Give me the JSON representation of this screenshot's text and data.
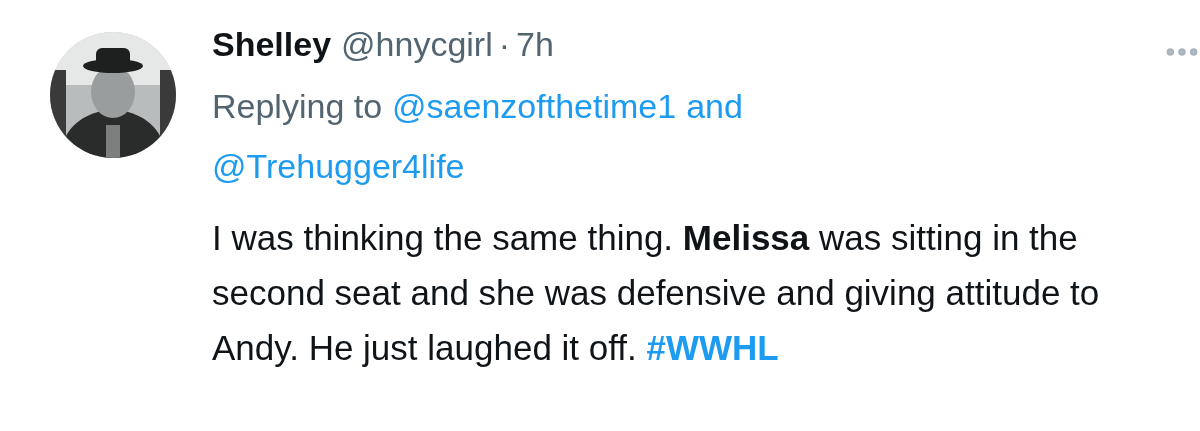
{
  "tweet": {
    "name": "Shelley",
    "handle": "@hnycgirl",
    "separator": "·",
    "time": "7h",
    "replying": {
      "prefix": "Replying to",
      "mentions": [
        "@saenzofthetime1",
        "@Trehugger4life"
      ],
      "conjunction": "and"
    },
    "body": "I was thinking the same thing. **Melissa** was sitting in the second seat and she was defensive and giving attitude to Andy. He just laughed it off.",
    "hashtag": "#WWHL"
  }
}
